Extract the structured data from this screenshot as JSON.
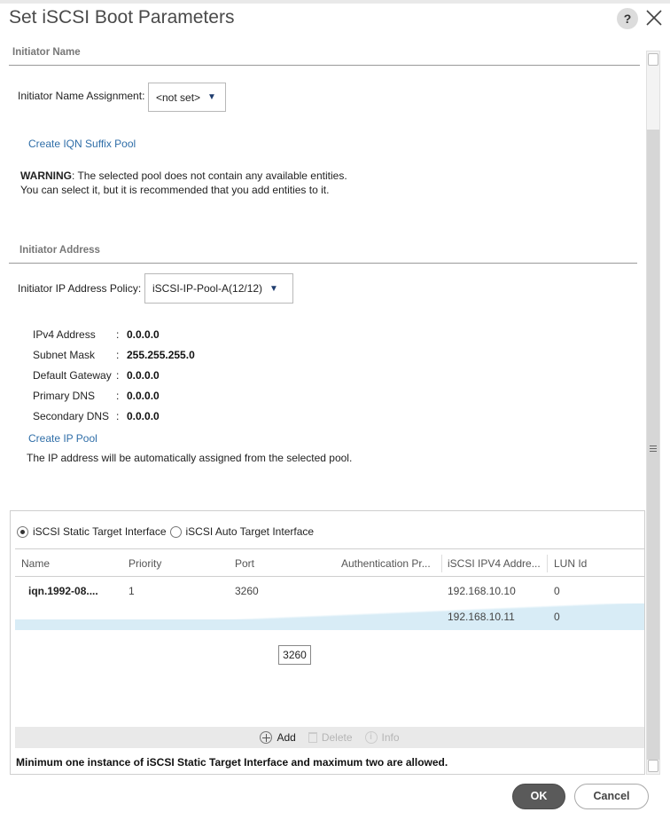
{
  "dialog": {
    "title": "Set iSCSI Boot Parameters",
    "help_label": "?",
    "close_icon": "close-icon"
  },
  "initiator_name": {
    "section_title": "Initiator Name",
    "assignment_label": "Initiator Name Assignment:",
    "assignment_value": "<not set>",
    "create_pool_link": "Create IQN Suffix Pool",
    "warning_prefix": "WARNING",
    "warning_line1": ": The selected pool does not contain any available entities.",
    "warning_line2": "You can select it, but it is recommended that you add entities to it."
  },
  "initiator_address": {
    "section_title": "Initiator Address",
    "policy_label": "Initiator IP Address Policy:",
    "policy_value": "iSCSI-IP-Pool-A(12/12)",
    "fields": [
      {
        "label": "IPv4 Address",
        "value": "0.0.0.0"
      },
      {
        "label": "Subnet Mask",
        "value": "255.255.255.0"
      },
      {
        "label": "Default Gateway",
        "value": "0.0.0.0"
      },
      {
        "label": "Primary DNS",
        "value": "0.0.0.0"
      },
      {
        "label": "Secondary DNS",
        "value": "0.0.0.0"
      }
    ],
    "create_ip_pool_link": "Create IP Pool",
    "note": "The IP address will be automatically assigned from the selected pool."
  },
  "target": {
    "static_option": "iSCSI Static Target Interface",
    "auto_option": "iSCSI Auto Target Interface",
    "selected_option": "static",
    "columns": [
      "Name",
      "Priority",
      "Port",
      "Authentication Pr...",
      "iSCSI IPV4 Addre...",
      "LUN Id"
    ],
    "rows": [
      {
        "name": "iqn.1992-08....",
        "priority": "1",
        "port": "3260",
        "auth": "",
        "ipv4": "192.168.10.10",
        "lun": "0"
      },
      {
        "name": "",
        "priority": "",
        "port": "",
        "auth": "",
        "ipv4": "192.168.10.11",
        "lun": "0"
      }
    ],
    "editor_value": "3260",
    "toolbar": {
      "add_label": "Add",
      "delete_label": "Delete",
      "info_label": "Info"
    },
    "footnote": "Minimum one instance of iSCSI Static Target Interface and maximum two are allowed."
  },
  "buttons": {
    "ok_label": "OK",
    "cancel_label": "Cancel"
  },
  "colors": {
    "link": "#2f6ea8",
    "selected_row": "#d8ecf6",
    "ok_button": "#5a5a5a"
  }
}
